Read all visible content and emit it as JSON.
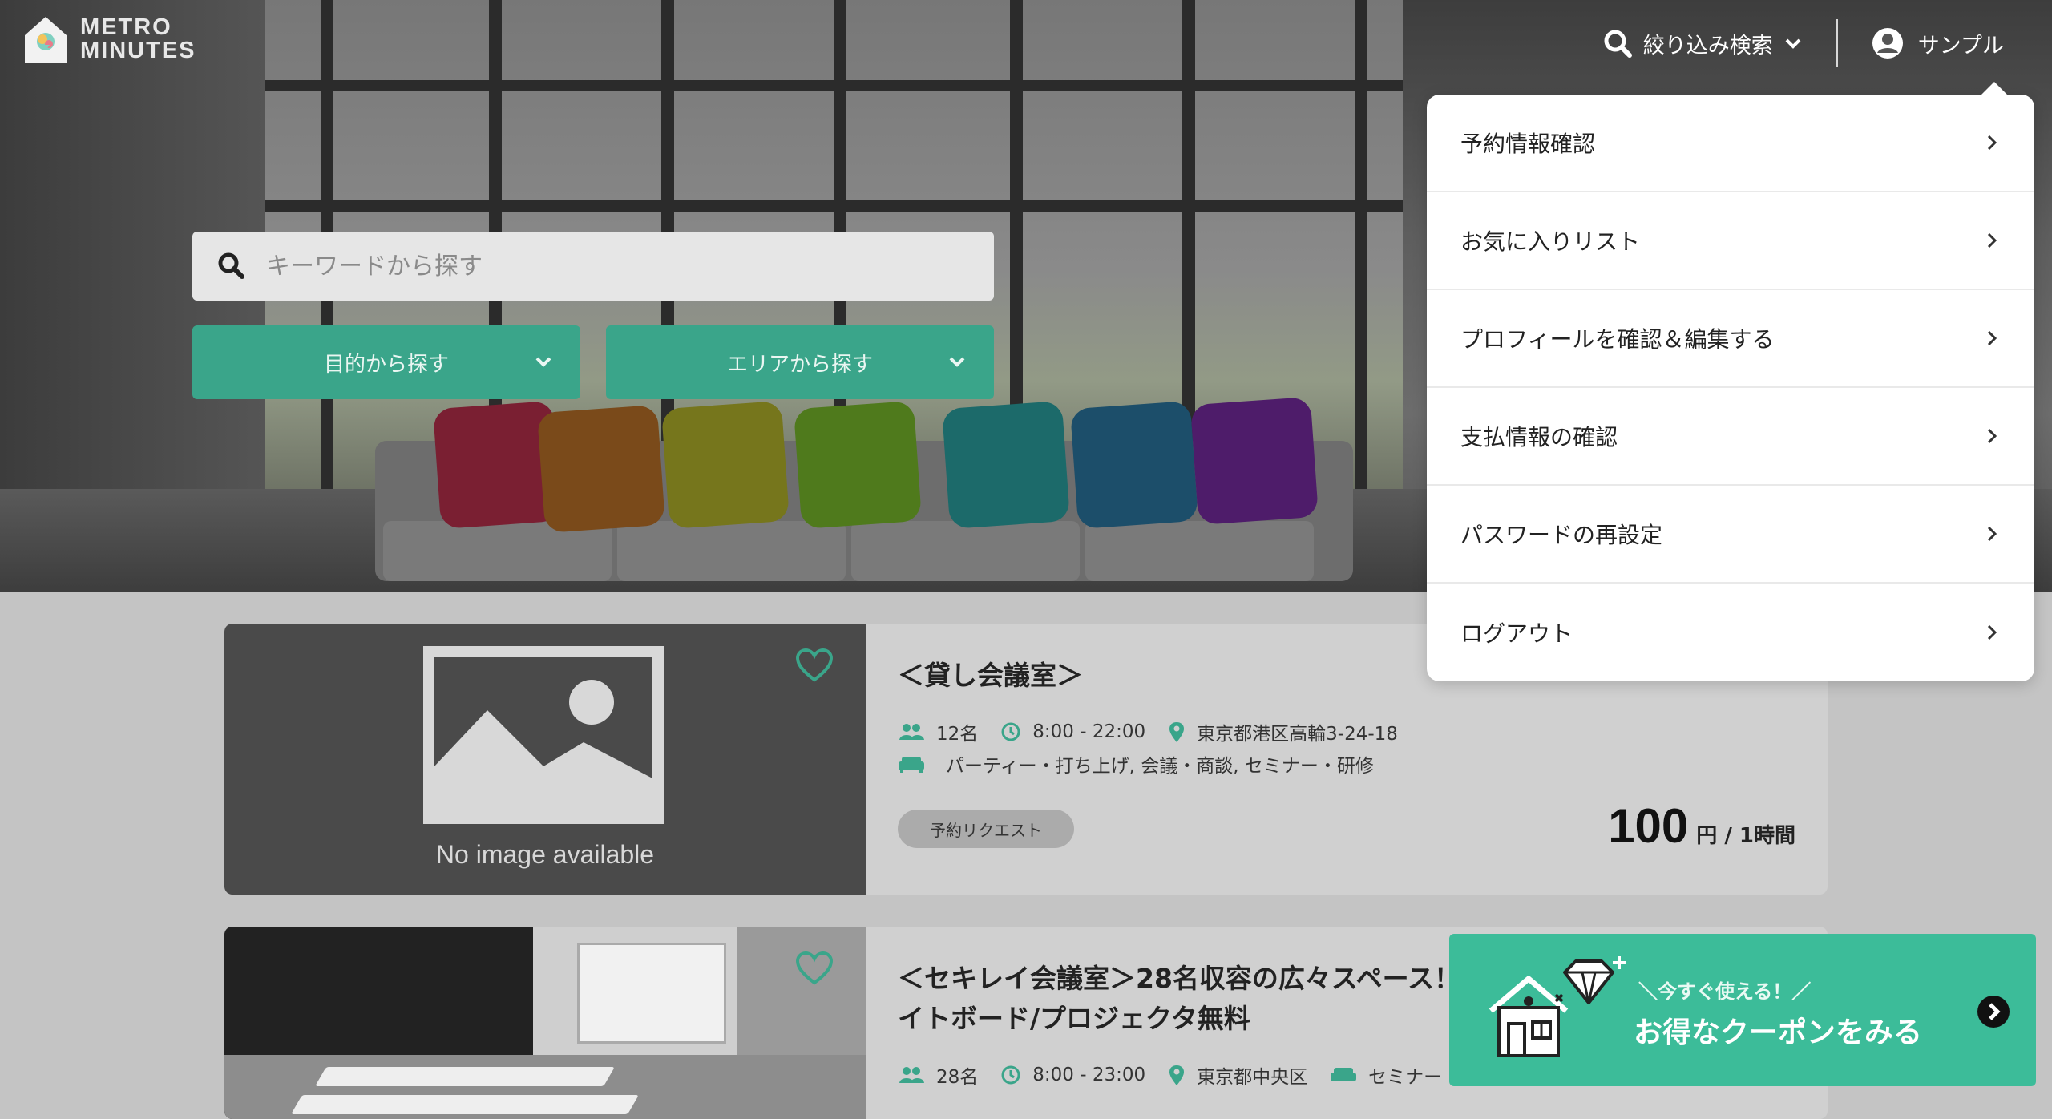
{
  "brand": {
    "line1": "METRO",
    "line2": "MINUTES"
  },
  "nav": {
    "filter_label": "絞り込み検索",
    "user_name": "サンプル"
  },
  "search": {
    "placeholder": "キーワードから探す"
  },
  "filters": {
    "purpose_label": "目的から探す",
    "area_label": "エリアから探す"
  },
  "user_menu": {
    "items": [
      {
        "label": "予約情報確認"
      },
      {
        "label": "お気に入りリスト"
      },
      {
        "label": "プロフィールを確認＆編集する"
      },
      {
        "label": "支払情報の確認"
      },
      {
        "label": "パスワードの再設定"
      },
      {
        "label": "ログアウト"
      }
    ]
  },
  "listings": [
    {
      "title": "＜貸し会議室＞",
      "capacity": "12名",
      "hours": "8:00 - 22:00",
      "address": "東京都港区高輪3-24-18",
      "purposes": "パーティー・打ち上げ, 会議・商談, セミナー・研修",
      "badge": "予約リクエスト",
      "price": "100",
      "price_unit": "円 / 1時間",
      "no_image_text": "No image available"
    },
    {
      "title_line1": "＜セキレイ会議室＞28名収容の広々スペース！ホ",
      "title_line2": "イトボード/プロジェクタ無料",
      "capacity": "28名",
      "hours": "8:00 - 23:00",
      "address": "東京都中央区",
      "purposes": "セミナー"
    }
  ],
  "coupon": {
    "subtitle": "＼今すぐ使える！／",
    "title": "お得なクーポンをみる"
  },
  "colors": {
    "accent": "#3aa58a",
    "coupon": "#3cbc99",
    "menu_bg": "#ffffff"
  },
  "icons": [
    "search-icon",
    "chevron-down-icon",
    "user-circle-icon",
    "chevron-right-icon",
    "heart-icon",
    "people-icon",
    "clock-icon",
    "map-pin-icon",
    "sofa-icon",
    "house-icon",
    "diamond-icon",
    "arrow-circle-icon"
  ]
}
